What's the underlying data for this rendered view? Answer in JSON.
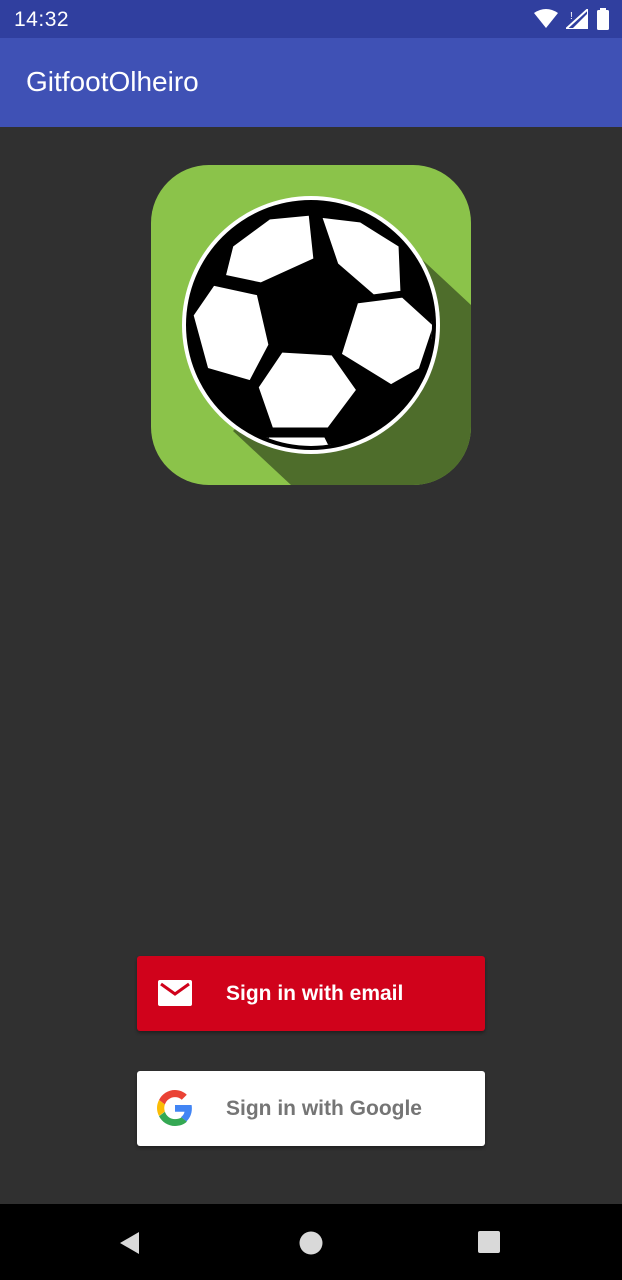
{
  "status_bar": {
    "time": "14:32",
    "icons": [
      "wifi-icon",
      "signal-icon",
      "battery-icon"
    ]
  },
  "app_bar": {
    "title": "GitfootOlheiro",
    "color": "#3F51B5"
  },
  "logo": {
    "icon": "soccer-ball-icon",
    "background_color": "#8BC34A"
  },
  "auth": {
    "email_button": {
      "label": "Sign in with email",
      "icon": "mail-icon",
      "color": "#D0021B"
    },
    "google_button": {
      "label": "Sign in with Google",
      "icon": "google-icon",
      "color": "#FFFFFF"
    }
  },
  "nav_bar": {
    "buttons": [
      "back-icon",
      "home-icon",
      "recents-icon"
    ]
  }
}
